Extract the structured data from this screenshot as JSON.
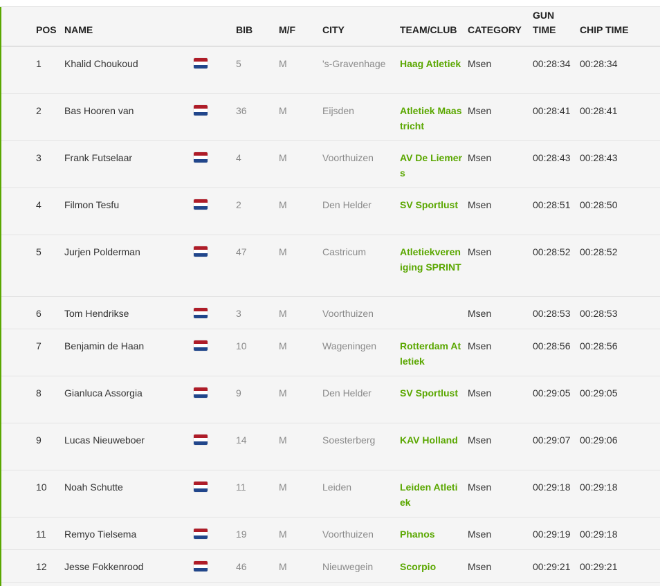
{
  "colors": {
    "accent": "#5aa700",
    "flag_red": "#ae1c28",
    "flag_white": "#ffffff",
    "flag_blue": "#21468b"
  },
  "headers": {
    "pos": "POS",
    "name": "NAME",
    "bib": "BIB",
    "mf": "M/F",
    "city": "CITY",
    "team": "TEAM/CLUB",
    "category": "CATEGORY",
    "gun_l1": "GUN",
    "gun_l2": "TIME",
    "chip": "CHIP TIME"
  },
  "rows": [
    {
      "pos": "1",
      "name": "Khalid Choukoud",
      "flag": "netherlands-flag-icon",
      "bib": "5",
      "mf": "M",
      "city": "'s-Gravenhage",
      "team": "Haag Atletiek",
      "category": "Msen",
      "gun": "00:28:34",
      "chip": "00:28:34"
    },
    {
      "pos": "2",
      "name": "Bas Hooren van",
      "flag": "netherlands-flag-icon",
      "bib": "36",
      "mf": "M",
      "city": "Eijsden",
      "team": "Atletiek Maastricht",
      "category": "Msen",
      "gun": "00:28:41",
      "chip": "00:28:41"
    },
    {
      "pos": "3",
      "name": "Frank Futselaar",
      "flag": "netherlands-flag-icon",
      "bib": "4",
      "mf": "M",
      "city": "Voorthuizen",
      "team": "AV De Liemers",
      "category": "Msen",
      "gun": "00:28:43",
      "chip": "00:28:43"
    },
    {
      "pos": "4",
      "name": "Filmon Tesfu",
      "flag": "netherlands-flag-icon",
      "bib": "2",
      "mf": "M",
      "city": "Den Helder",
      "team": "SV Sportlust",
      "category": "Msen",
      "gun": "00:28:51",
      "chip": "00:28:50"
    },
    {
      "pos": "5",
      "name": "Jurjen Polderman",
      "flag": "netherlands-flag-icon",
      "bib": "47",
      "mf": "M",
      "city": "Castricum",
      "team": "Atletiekvereniging SPRINT",
      "category": "Msen",
      "gun": "00:28:52",
      "chip": "00:28:52"
    },
    {
      "pos": "6",
      "name": "Tom Hendrikse",
      "flag": "netherlands-flag-icon",
      "bib": "3",
      "mf": "M",
      "city": "Voorthuizen",
      "team": "",
      "category": "Msen",
      "gun": "00:28:53",
      "chip": "00:28:53"
    },
    {
      "pos": "7",
      "name": "Benjamin de Haan",
      "flag": "netherlands-flag-icon",
      "bib": "10",
      "mf": "M",
      "city": "Wageningen",
      "team": "Rotterdam Atletiek",
      "category": "Msen",
      "gun": "00:28:56",
      "chip": "00:28:56"
    },
    {
      "pos": "8",
      "name": "Gianluca Assorgia",
      "flag": "netherlands-flag-icon",
      "bib": "9",
      "mf": "M",
      "city": "Den Helder",
      "team": "SV Sportlust",
      "category": "Msen",
      "gun": "00:29:05",
      "chip": "00:29:05"
    },
    {
      "pos": "9",
      "name": "Lucas Nieuweboer",
      "flag": "netherlands-flag-icon",
      "bib": "14",
      "mf": "M",
      "city": "Soesterberg",
      "team": "KAV Holland",
      "category": "Msen",
      "gun": "00:29:07",
      "chip": "00:29:06"
    },
    {
      "pos": "10",
      "name": "Noah Schutte",
      "flag": "netherlands-flag-icon",
      "bib": "11",
      "mf": "M",
      "city": "Leiden",
      "team": "Leiden Atletiek",
      "category": "Msen",
      "gun": "00:29:18",
      "chip": "00:29:18"
    },
    {
      "pos": "11",
      "name": "Remyo Tielsema",
      "flag": "netherlands-flag-icon",
      "bib": "19",
      "mf": "M",
      "city": "Voorthuizen",
      "team": "Phanos",
      "category": "Msen",
      "gun": "00:29:19",
      "chip": "00:29:18"
    },
    {
      "pos": "12",
      "name": "Jesse Fokkenrood",
      "flag": "netherlands-flag-icon",
      "bib": "46",
      "mf": "M",
      "city": "Nieuwegein",
      "team": "Scorpio",
      "category": "Msen",
      "gun": "00:29:21",
      "chip": "00:29:21"
    }
  ]
}
